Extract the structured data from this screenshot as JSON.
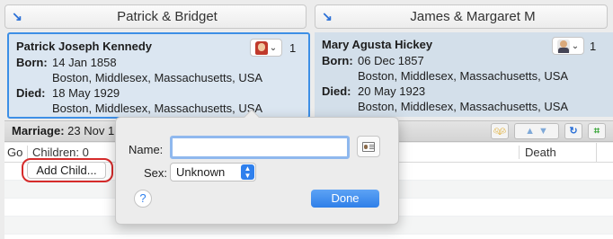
{
  "left_family": {
    "header_title": "Patrick & Bridget",
    "person": {
      "name": "Patrick Joseph Kennedy",
      "born_label": "Born:",
      "born_date": "14 Jan 1858",
      "born_place": "Boston, Middlesex, Massachusetts, USA",
      "died_label": "Died:",
      "died_date": "18 May 1929",
      "died_place": "Boston, Middlesex, Massachusetts, USA",
      "photo_count": "1"
    }
  },
  "right_family": {
    "header_title": "James & Margaret M",
    "person": {
      "name": "Mary Agusta Hickey",
      "born_label": "Born:",
      "born_date": "06 Dec 1857",
      "born_place": "Boston, Middlesex, Massachusetts, USA",
      "died_label": "Died:",
      "died_date": "20 May 1923",
      "died_place": "Boston, Middlesex, Massachusetts, USA",
      "photo_count": "1"
    }
  },
  "marriage": {
    "label": "Marriage:",
    "value": "23 Nov 1"
  },
  "children_table": {
    "col_go": "Go",
    "col_children": "Children: 0",
    "col_death": "Death",
    "add_child_label": "Add Child..."
  },
  "popover": {
    "name_label": "Name:",
    "name_value": "",
    "sex_label": "Sex:",
    "sex_value": "Unknown",
    "help_label": "?",
    "done_label": "Done"
  },
  "icons": {
    "header_arrow": "navigate-arrow-icon",
    "female_avatar": "female-avatar-icon",
    "male_avatar": "male-avatar-icon",
    "card": "contact-card-icon"
  },
  "colors": {
    "selection_border": "#3d8fe6",
    "annotation_circle": "#d62b2b",
    "done_button": "#2f7fe8"
  }
}
